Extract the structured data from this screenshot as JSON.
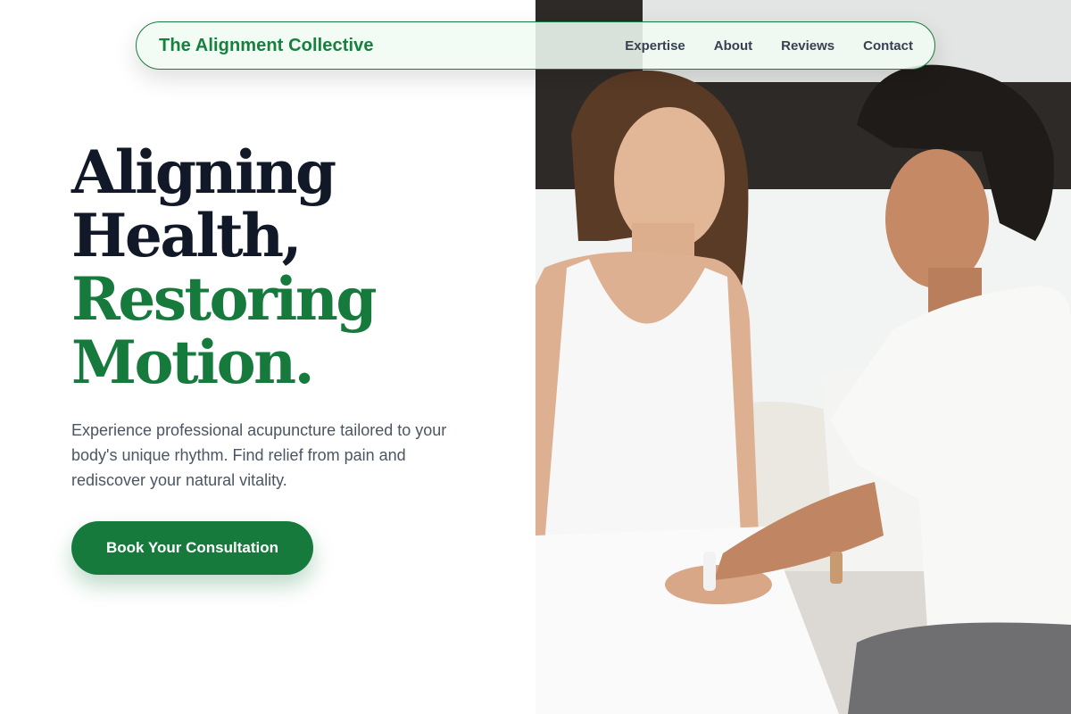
{
  "nav": {
    "brand": "The Alignment Collective",
    "links": [
      "Expertise",
      "About",
      "Reviews",
      "Contact"
    ]
  },
  "hero": {
    "headline": {
      "line1": "Aligning",
      "line2": "Health,",
      "line3": "Restoring",
      "line4": "Motion."
    },
    "description": "Experience professional acupuncture tailored to your body's unique rhythm. Find relief from pain and rediscover your natural vitality.",
    "cta_label": "Book Your Consultation"
  },
  "colors": {
    "brand_green": "#177a3d",
    "heading_dark": "#111827",
    "body_text": "#4b5563"
  }
}
